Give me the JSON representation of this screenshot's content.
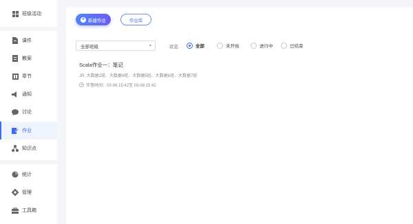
{
  "sidebar": {
    "items": [
      {
        "label": "班级活动",
        "icon": "grid-icon"
      },
      {
        "label": "课件",
        "icon": "file-icon"
      },
      {
        "label": "教案",
        "icon": "doc-icon"
      },
      {
        "label": "章节",
        "icon": "chapter-icon"
      },
      {
        "label": "通知",
        "icon": "bell-icon"
      },
      {
        "label": "讨论",
        "icon": "chat-icon"
      },
      {
        "label": "作业",
        "icon": "edit-icon",
        "active": true
      },
      {
        "label": "知识点",
        "icon": "nodes-icon"
      },
      {
        "label": "统计",
        "icon": "pie-chart-icon"
      },
      {
        "label": "管理",
        "icon": "gear-icon"
      },
      {
        "label": "工具箱",
        "icon": "toolbox-icon"
      }
    ]
  },
  "toolbar": {
    "new_homework_label": "新建作业",
    "homework_library_label": "作业库"
  },
  "filters": {
    "class_select_value": "全部班级",
    "status_label": "状态",
    "status_options": [
      "全部",
      "未开始",
      "进行中",
      "已结束"
    ],
    "selected_status": "全部"
  },
  "homework": {
    "title": "Scala作业一：笔记",
    "classes": "JR, 大数据2班、大数据4班、大数据5班、大数据6班、大数据7班",
    "time": "作答时间：03-06 15:42至 03-08 15:42"
  },
  "colors": {
    "accent": "#3a6cf4",
    "sidebar_bg": "#ffffff",
    "page_bg": "#f3f5f9"
  }
}
